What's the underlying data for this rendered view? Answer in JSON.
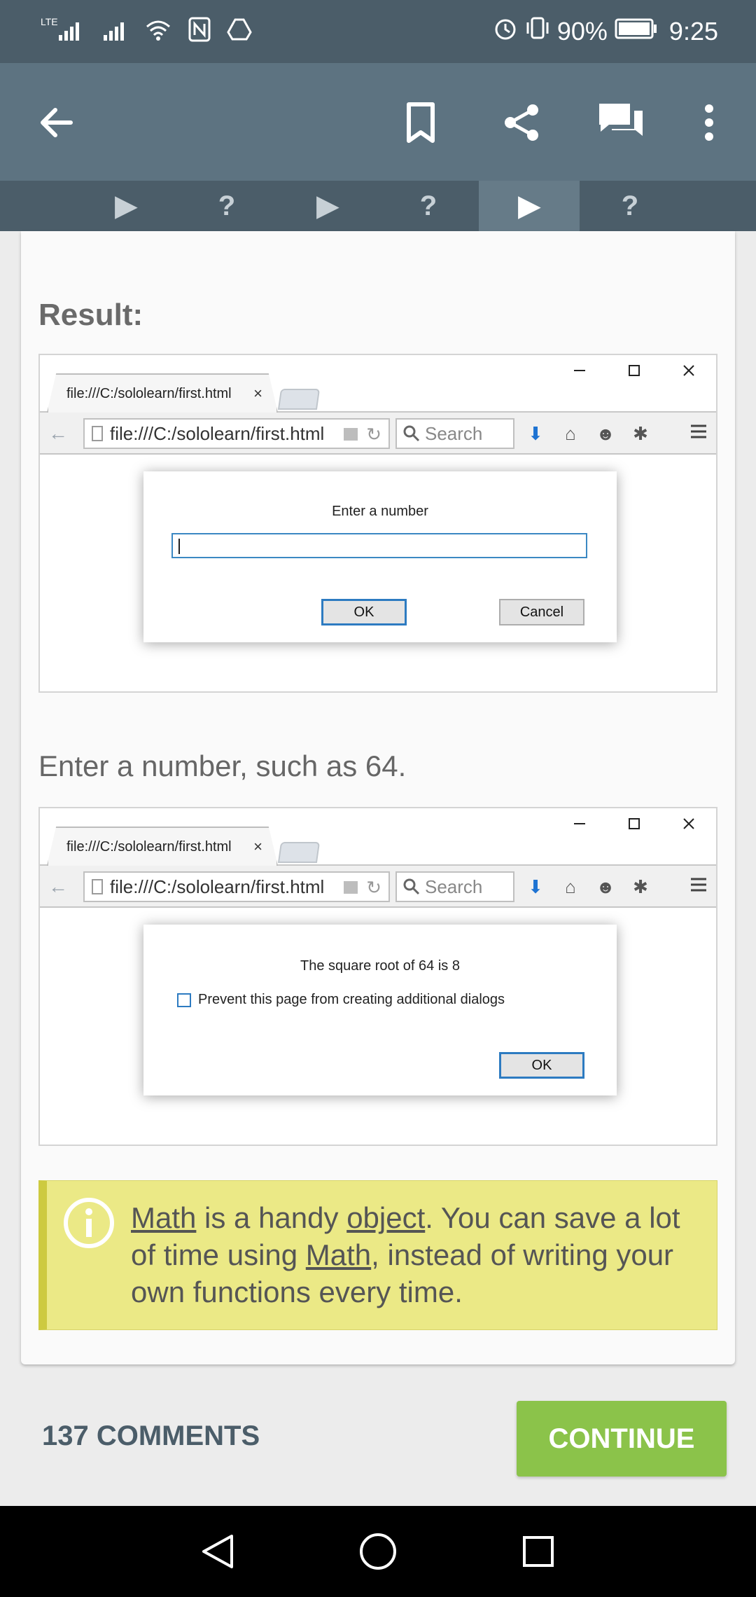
{
  "status_bar": {
    "network_label": "LTE",
    "battery": "90%",
    "time": "9:25"
  },
  "tabs": [
    "▶",
    "?",
    "▶",
    "?",
    "▶",
    "?"
  ],
  "lesson": {
    "result_title": "Result:",
    "instruction": "Enter a number, such as 64."
  },
  "browser": {
    "tab_title": "file:///C:/sololearn/first.html",
    "tab_close": "×",
    "url": "file:///C:/sololearn/first.html",
    "search_placeholder": "Search"
  },
  "dialog_prompt": {
    "title": "Enter a number",
    "input_value": "",
    "ok_label": "OK",
    "cancel_label": "Cancel"
  },
  "dialog_alert": {
    "message": "The square root of 64  is 8",
    "checkbox_label": "Prevent this page from creating additional dialogs",
    "ok_label": "OK"
  },
  "tip": {
    "part1": "Math",
    "part2": " is a handy ",
    "part3": "object",
    "part4": ". You can save a lot of time using ",
    "part5": "Math",
    "part6": ", instead of writing your own functions every time."
  },
  "footer": {
    "comments_label": "137 COMMENTS",
    "continue_label": "CONTINUE"
  },
  "colors": {
    "status_bar": "#4b5d69",
    "app_bar": "#5d7381",
    "continue": "#8bc34a",
    "tip_bg": "#ebe986"
  }
}
